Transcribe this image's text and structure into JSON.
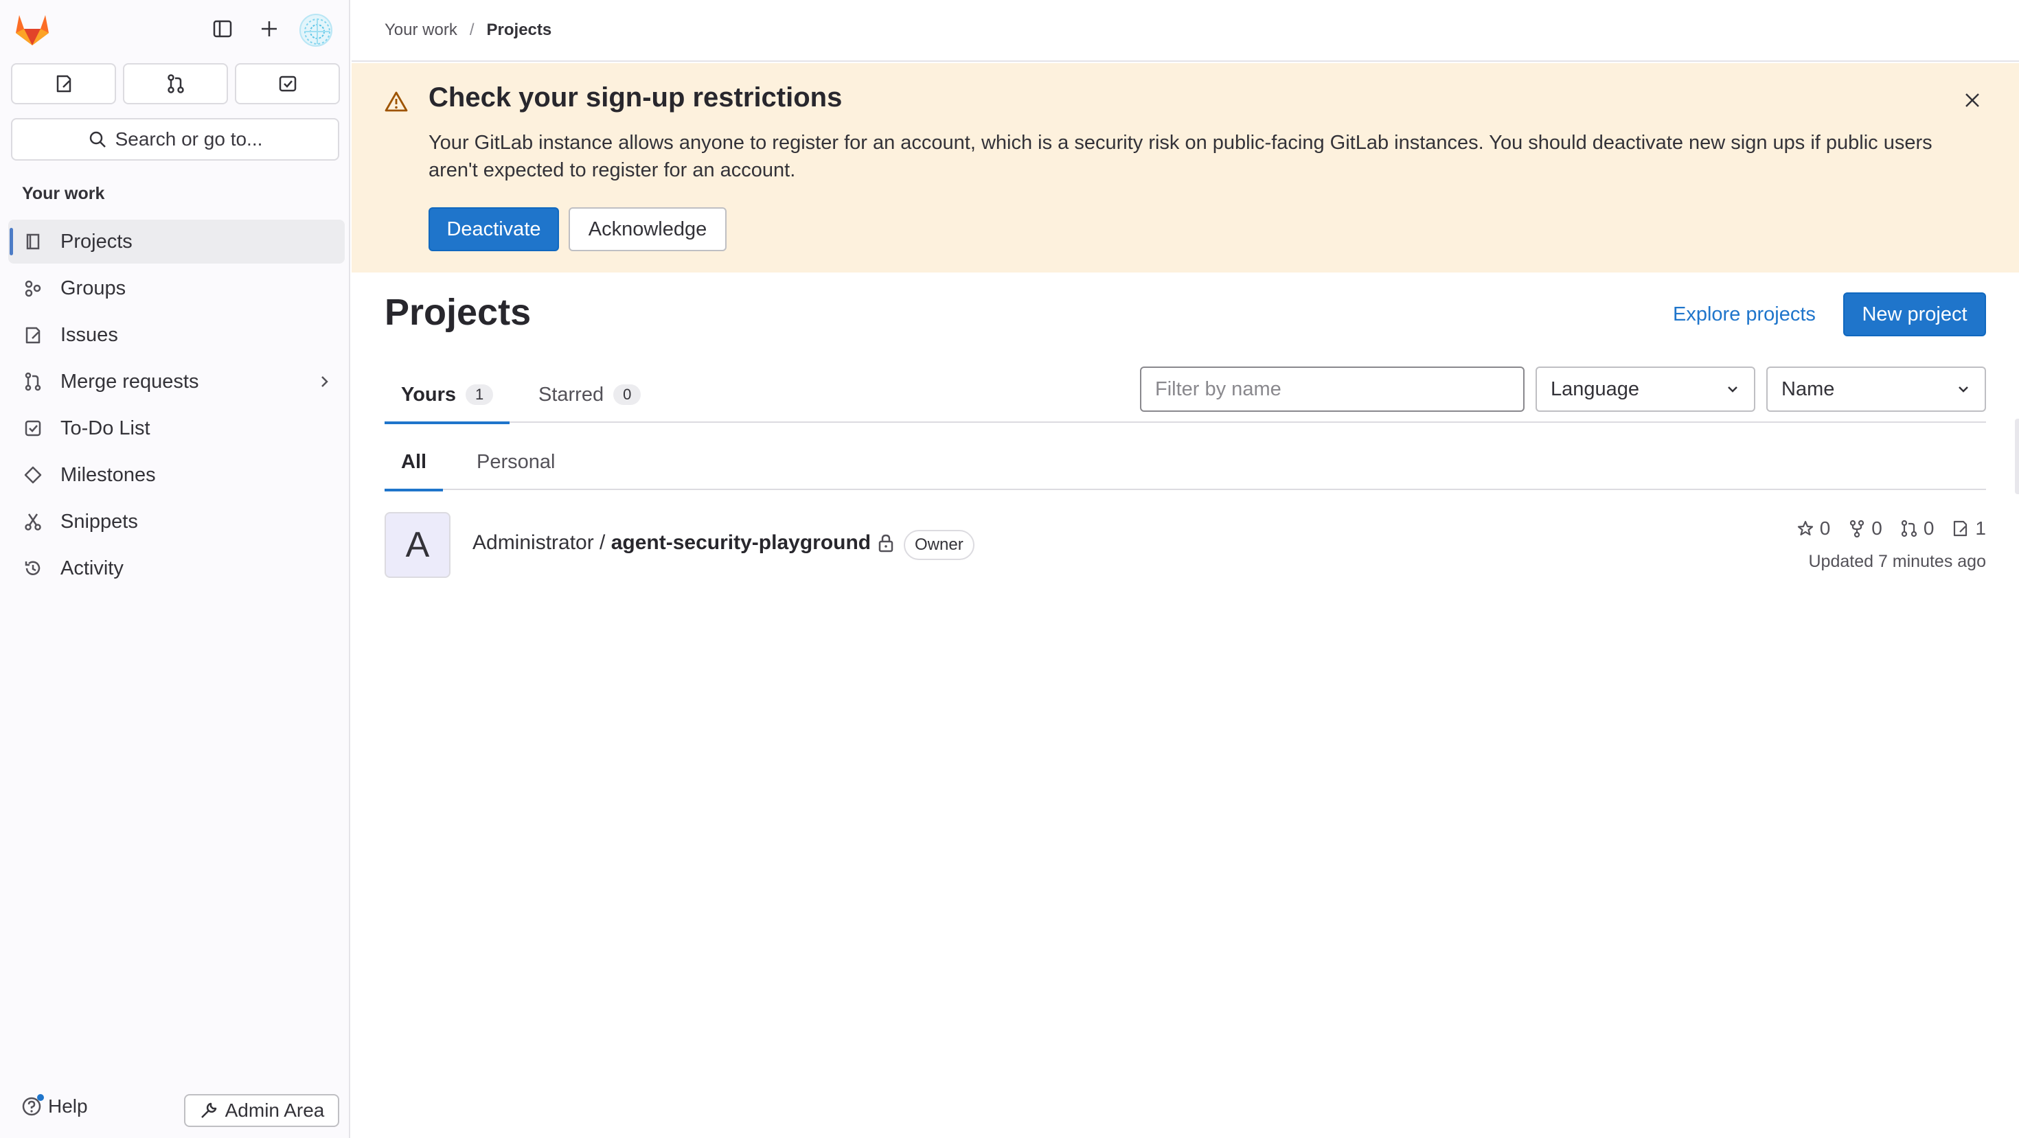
{
  "sidebar": {
    "section_title": "Your work",
    "search_label": "Search or go to...",
    "items": [
      {
        "label": "Projects"
      },
      {
        "label": "Groups"
      },
      {
        "label": "Issues"
      },
      {
        "label": "Merge requests"
      },
      {
        "label": "To-Do List"
      },
      {
        "label": "Milestones"
      },
      {
        "label": "Snippets"
      },
      {
        "label": "Activity"
      }
    ],
    "help_label": "Help",
    "admin_label": "Admin Area"
  },
  "breadcrumb": {
    "parent": "Your work",
    "separator": "/",
    "current": "Projects"
  },
  "alert": {
    "title": "Check your sign-up restrictions",
    "body": "Your GitLab instance allows anyone to register for an account, which is a security risk on public-facing GitLab instances. You should deactivate new sign ups if public users aren't expected to register for an account.",
    "primary_label": "Deactivate",
    "secondary_label": "Acknowledge"
  },
  "page": {
    "title": "Projects",
    "explore_label": "Explore projects",
    "new_label": "New project"
  },
  "tabs": [
    {
      "label": "Yours",
      "count": "1"
    },
    {
      "label": "Starred",
      "count": "0"
    }
  ],
  "filters": {
    "search_placeholder": "Filter by name",
    "language_label": "Language",
    "sort_label": "Name"
  },
  "subtabs": [
    {
      "label": "All"
    },
    {
      "label": "Personal"
    }
  ],
  "project": {
    "avatar_letter": "A",
    "namespace": "Administrator / ",
    "name": "agent-security-playground",
    "role": "Owner",
    "stars": "0",
    "forks": "0",
    "merge_requests": "0",
    "issues": "1",
    "updated": "Updated 7 minutes ago"
  },
  "colors": {
    "accent": "#1f75cb",
    "alert_bg": "#fdf1dd",
    "sidebar_bg": "#fbfafd"
  }
}
